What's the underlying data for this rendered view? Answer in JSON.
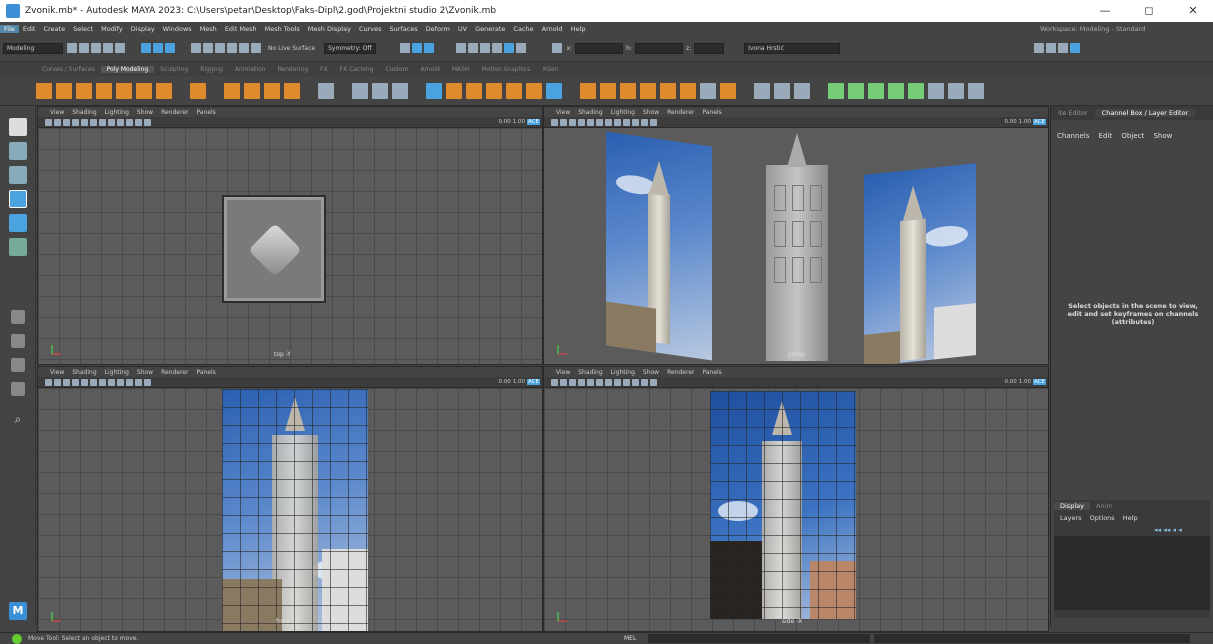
{
  "window": {
    "title": "Zvonik.mb* - Autodesk MAYA 2023: C:\\Users\\petar\\Desktop\\Faks-Dipl\\2.god\\Projektni studio 2\\Zvonik.mb",
    "min": "—",
    "max": "◻",
    "close": "✕"
  },
  "menu": [
    "File",
    "Edit",
    "Create",
    "Select",
    "Modify",
    "Display",
    "Windows",
    "Mesh",
    "Edit Mesh",
    "Mesh Tools",
    "Mesh Display",
    "Curves",
    "Surfaces",
    "Deform",
    "UV",
    "Generate",
    "Cache",
    "Arnold",
    "Help"
  ],
  "workspace": "Workspace: Modeling - Standard",
  "status": {
    "mode": "Modeling",
    "live": "No Live Surface",
    "symmetry": "Symmetry: Off",
    "user": "Ivona Hrstić",
    "x": "x:",
    "y": "h:",
    "z": "z:"
  },
  "shelf_tabs": [
    "Curves / Surfaces",
    "Poly Modeling",
    "Sculpting",
    "Rigging",
    "Animation",
    "Rendering",
    "FX",
    "FX Caching",
    "Custom",
    "Arnold",
    "MASH",
    "Motion Graphics",
    "XGen"
  ],
  "viewport_menu": [
    "View",
    "Shading",
    "Lighting",
    "Show",
    "Renderer",
    "Panels"
  ],
  "viewport_values": {
    "v1": "0.00",
    "v2": "1.00",
    "ace": "ACE"
  },
  "viewports": {
    "top": "top -Y",
    "persp": "persp",
    "front": "front -Z",
    "side": "side -X"
  },
  "right_tabs": [
    "ite Editor",
    "Channel Box / Layer Editor"
  ],
  "channel_menu": [
    "Channels",
    "Edit",
    "Object",
    "Show"
  ],
  "channel_help": "Select objects in the scene to view, edit and set keyframes on channels (attributes)",
  "layer_tabs": [
    "Display",
    "Anim"
  ],
  "layer_menu": [
    "Layers",
    "Options",
    "Help"
  ],
  "help_line": "Move Tool: Select an object to move.",
  "mel": "MEL",
  "maya_badge": "M",
  "colors": {
    "accent": "#5285a6",
    "shelf_orange": "#e08a2e",
    "bg": "#444444"
  }
}
